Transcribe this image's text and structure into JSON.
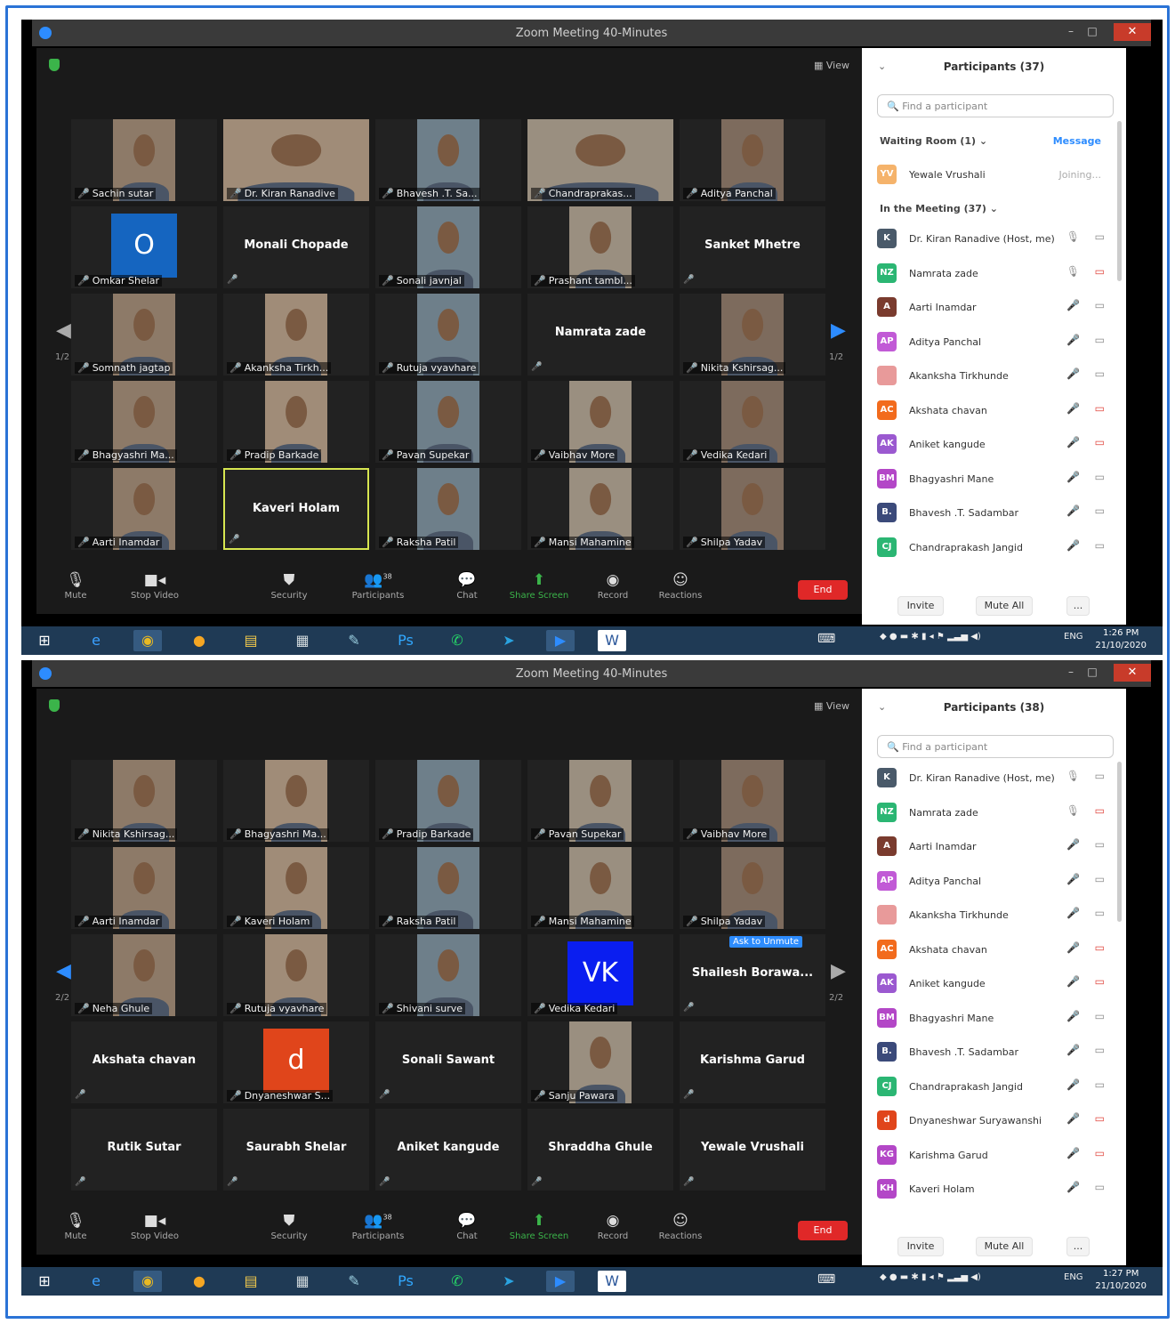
{
  "shot1": {
    "window_title": "Zoom Meeting 40-Minutes",
    "view_label": "View",
    "page_left": "1/2",
    "page_right": "1/2",
    "participants_header": "Participants (37)",
    "search_placeholder": "Find a participant",
    "waiting_room_label": "Waiting Room (1)",
    "message_label": "Message",
    "waiting": {
      "name": "Yewale Vrushali",
      "status": "Joining...",
      "initials": "YV",
      "color": "#f5b36b"
    },
    "in_meeting_label": "In the Meeting (37)",
    "tiles": [
      {
        "name": "Sachin sutar",
        "kind": "photo"
      },
      {
        "name": "Dr. Kiran Ranadive",
        "kind": "wide"
      },
      {
        "name": "Bhavesh .T. Sa...",
        "kind": "photo"
      },
      {
        "name": "Chandraprakas...",
        "kind": "wide"
      },
      {
        "name": "Aditya Panchal",
        "kind": "photo"
      },
      {
        "name": "Omkar Shelar",
        "kind": "letter",
        "letter": "O",
        "color": "#1565c0"
      },
      {
        "name": "Monali Chopade",
        "kind": "nametile"
      },
      {
        "name": "Sonali javnjal",
        "kind": "photo"
      },
      {
        "name": "Prashant tambl...",
        "kind": "photo"
      },
      {
        "name": "Sanket Mhetre",
        "kind": "nametile"
      },
      {
        "name": "Somnath jagtap",
        "kind": "photo"
      },
      {
        "name": "Akanksha Tirkh...",
        "kind": "photo"
      },
      {
        "name": "Rutuja vyavhare",
        "kind": "photo"
      },
      {
        "name": "Namrata zade",
        "kind": "nametile"
      },
      {
        "name": "Nikita Kshirsag...",
        "kind": "photo"
      },
      {
        "name": "Bhagyashri Ma...",
        "kind": "photo"
      },
      {
        "name": "Pradip Barkade",
        "kind": "photo"
      },
      {
        "name": "Pavan Supekar",
        "kind": "photo"
      },
      {
        "name": "Vaibhav More",
        "kind": "photo"
      },
      {
        "name": "Vedika Kedari",
        "kind": "photo"
      },
      {
        "name": "Aarti Inamdar",
        "kind": "photo"
      },
      {
        "name": "Kaveri Holam",
        "kind": "nametile",
        "highlight": true
      },
      {
        "name": "Raksha Patil",
        "kind": "photo"
      },
      {
        "name": "Mansi Mahamine",
        "kind": "photo"
      },
      {
        "name": "Shilpa Yadav",
        "kind": "photo"
      }
    ],
    "participants": [
      {
        "initials": "K",
        "name": "Dr. Kiran Ranadive (Host, me)",
        "color": "#4a5a6a",
        "mic": "on",
        "cam": "on"
      },
      {
        "initials": "NZ",
        "name": "Namrata zade",
        "color": "#2bb673",
        "mic": "on",
        "cam": "off"
      },
      {
        "initials": "A",
        "name": "Aarti Inamdar",
        "color": "#7a3b2e",
        "mic": "off",
        "cam": "on"
      },
      {
        "initials": "AP",
        "name": "Aditya Panchal",
        "color": "#c15ad6",
        "mic": "off",
        "cam": "on"
      },
      {
        "initials": "",
        "name": "Akanksha Tirkhunde",
        "color": "#e89a9a",
        "mic": "off",
        "cam": "on"
      },
      {
        "initials": "AC",
        "name": "Akshata chavan",
        "color": "#f26b1d",
        "mic": "off",
        "cam": "off"
      },
      {
        "initials": "AK",
        "name": "Aniket kangude",
        "color": "#9b59d0",
        "mic": "off",
        "cam": "off"
      },
      {
        "initials": "BM",
        "name": "Bhagyashri Mane",
        "color": "#b347c7",
        "mic": "off",
        "cam": "on"
      },
      {
        "initials": "B.",
        "name": "Bhavesh .T. Sadambar",
        "color": "#3b4a7a",
        "mic": "off",
        "cam": "on"
      },
      {
        "initials": "CJ",
        "name": "Chandraprakash Jangid",
        "color": "#2bb673",
        "mic": "off",
        "cam": "on"
      }
    ],
    "clock_time": "1:26 PM",
    "clock_date": "21/10/2020"
  },
  "shot2": {
    "window_title": "Zoom Meeting 40-Minutes",
    "view_label": "View",
    "page_left": "2/2",
    "page_right": "2/2",
    "participants_header": "Participants (38)",
    "search_placeholder": "Find a participant",
    "ask_unmute": "Ask to Unmute",
    "tiles": [
      {
        "name": "Nikita Kshirsag...",
        "kind": "photo"
      },
      {
        "name": "Bhagyashri Ma...",
        "kind": "photo"
      },
      {
        "name": "Pradip Barkade",
        "kind": "photo"
      },
      {
        "name": "Pavan Supekar",
        "kind": "photo"
      },
      {
        "name": "Vaibhav More",
        "kind": "photo"
      },
      {
        "name": "Aarti Inamdar",
        "kind": "photo"
      },
      {
        "name": "Kaveri Holam",
        "kind": "photo"
      },
      {
        "name": "Raksha Patil",
        "kind": "photo"
      },
      {
        "name": "Mansi Mahamine",
        "kind": "photo"
      },
      {
        "name": "Shilpa Yadav",
        "kind": "photo"
      },
      {
        "name": "Neha Ghule",
        "kind": "photo"
      },
      {
        "name": "Rutuja vyavhare",
        "kind": "photo"
      },
      {
        "name": "Shivani surve",
        "kind": "photo"
      },
      {
        "name": "Vedika Kedari",
        "kind": "letter",
        "letter": "VK",
        "color": "#0a1ef0"
      },
      {
        "name": "Shailesh Borawa...",
        "kind": "nametile",
        "ask": true
      },
      {
        "name": "Akshata chavan",
        "kind": "nametile"
      },
      {
        "name": "Dnyaneshwar S...",
        "kind": "letter",
        "letter": "d",
        "color": "#e0451b"
      },
      {
        "name": "Sonali Sawant",
        "kind": "nametile"
      },
      {
        "name": "Sanju Pawara",
        "kind": "photo"
      },
      {
        "name": "Karishma Garud",
        "kind": "nametile"
      },
      {
        "name": "Rutik Sutar",
        "kind": "nametile"
      },
      {
        "name": "Saurabh Shelar",
        "kind": "nametile"
      },
      {
        "name": "Aniket kangude",
        "kind": "nametile"
      },
      {
        "name": "Shraddha Ghule",
        "kind": "nametile"
      },
      {
        "name": "Yewale Vrushali",
        "kind": "nametile"
      }
    ],
    "participants": [
      {
        "initials": "K",
        "name": "Dr. Kiran Ranadive (Host, me)",
        "color": "#4a5a6a",
        "mic": "on",
        "cam": "on"
      },
      {
        "initials": "NZ",
        "name": "Namrata zade",
        "color": "#2bb673",
        "mic": "on",
        "cam": "off"
      },
      {
        "initials": "A",
        "name": "Aarti Inamdar",
        "color": "#7a3b2e",
        "mic": "off",
        "cam": "on"
      },
      {
        "initials": "AP",
        "name": "Aditya Panchal",
        "color": "#c15ad6",
        "mic": "off",
        "cam": "on"
      },
      {
        "initials": "",
        "name": "Akanksha Tirkhunde",
        "color": "#e89a9a",
        "mic": "off",
        "cam": "on"
      },
      {
        "initials": "AC",
        "name": "Akshata chavan",
        "color": "#f26b1d",
        "mic": "off",
        "cam": "off"
      },
      {
        "initials": "AK",
        "name": "Aniket kangude",
        "color": "#9b59d0",
        "mic": "off",
        "cam": "off"
      },
      {
        "initials": "BM",
        "name": "Bhagyashri Mane",
        "color": "#b347c7",
        "mic": "off",
        "cam": "on"
      },
      {
        "initials": "B.",
        "name": "Bhavesh .T. Sadambar",
        "color": "#3b4a7a",
        "mic": "off",
        "cam": "on"
      },
      {
        "initials": "CJ",
        "name": "Chandraprakash Jangid",
        "color": "#2bb673",
        "mic": "off",
        "cam": "on"
      },
      {
        "initials": "d",
        "name": "Dnyaneshwar Suryawanshi",
        "color": "#e0451b",
        "mic": "off",
        "cam": "off"
      },
      {
        "initials": "KG",
        "name": "Karishma Garud",
        "color": "#b347c7",
        "mic": "off",
        "cam": "off"
      },
      {
        "initials": "KH",
        "name": "Kaveri Holam",
        "color": "#b347c7",
        "mic": "off",
        "cam": "on"
      }
    ],
    "clock_time": "1:27 PM",
    "clock_date": "21/10/2020"
  },
  "toolbar": {
    "mute": "Mute",
    "stop_video": "Stop Video",
    "security": "Security",
    "participants": "Participants",
    "participants_count": "38",
    "chat": "Chat",
    "share_screen": "Share Screen",
    "record": "Record",
    "reactions": "Reactions",
    "end": "End"
  },
  "panel_buttons": {
    "invite": "Invite",
    "mute_all": "Mute All",
    "more": "..."
  },
  "taskbar": {
    "lang": "ENG",
    "icons": [
      "start-icon",
      "ie-icon",
      "chrome-icon",
      "media-icon",
      "explorer-icon",
      "calculator-icon",
      "paint-icon",
      "photoshop-icon",
      "whatsapp-icon",
      "telegram-icon",
      "zoom-icon",
      "word-icon"
    ]
  }
}
